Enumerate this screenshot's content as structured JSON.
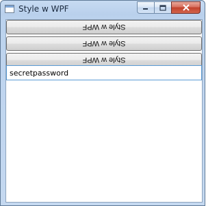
{
  "window": {
    "title": "Style w WPF",
    "icons": {
      "app": "app-window-icon",
      "minimize": "minimize-icon",
      "maximize": "maximize-icon",
      "close": "close-icon"
    }
  },
  "buttons": [
    {
      "label": "Style w WPF"
    },
    {
      "label": "Style w WPF"
    },
    {
      "label": "Style w WPF"
    }
  ],
  "password": {
    "value": "secretpassword"
  }
}
